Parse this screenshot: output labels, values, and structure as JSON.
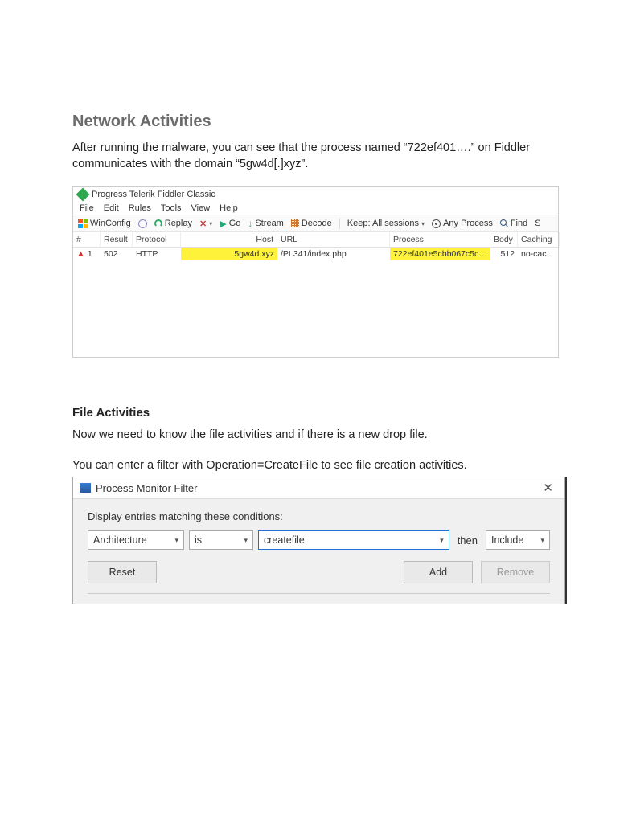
{
  "section1": {
    "title": "Network Activities",
    "paragraph": "After running the malware, you can see that the process named “722ef401….” on Fiddler communicates with the domain “5gw4d[.]xyz”."
  },
  "fiddler": {
    "title": "Progress Telerik Fiddler Classic",
    "menu": [
      "File",
      "Edit",
      "Rules",
      "Tools",
      "View",
      "Help"
    ],
    "toolbar": {
      "winconfig": "WinConfig",
      "replay": "Replay",
      "go": "Go",
      "stream": "Stream",
      "decode": "Decode",
      "keep": "Keep: All sessions",
      "anyprocess": "Any Process",
      "find": "Find",
      "save": "S"
    },
    "headers": {
      "num": "#",
      "result": "Result",
      "protocol": "Protocol",
      "host": "Host",
      "url": "URL",
      "process": "Process",
      "body": "Body",
      "caching": "Caching"
    },
    "row": {
      "num": "1",
      "result": "502",
      "protocol": "HTTP",
      "host": "5gw4d.xyz",
      "url": "/PL341/index.php",
      "process": "722ef401e5cbb067c5c3…",
      "body": "512",
      "caching": "no-cac.."
    }
  },
  "section2": {
    "title": "File Activities",
    "paragraph1": "Now we need to know the file activities and if there is a new drop file.",
    "paragraph2": "You can enter a filter with Operation=CreateFile to see file creation activities."
  },
  "pm": {
    "title": "Process Monitor Filter",
    "label": "Display entries matching these conditions:",
    "col_select": "Architecture",
    "op_select": "is",
    "value_input": "createfile",
    "then": "then",
    "action_select": "Include",
    "buttons": {
      "reset": "Reset",
      "add": "Add",
      "remove": "Remove"
    }
  }
}
